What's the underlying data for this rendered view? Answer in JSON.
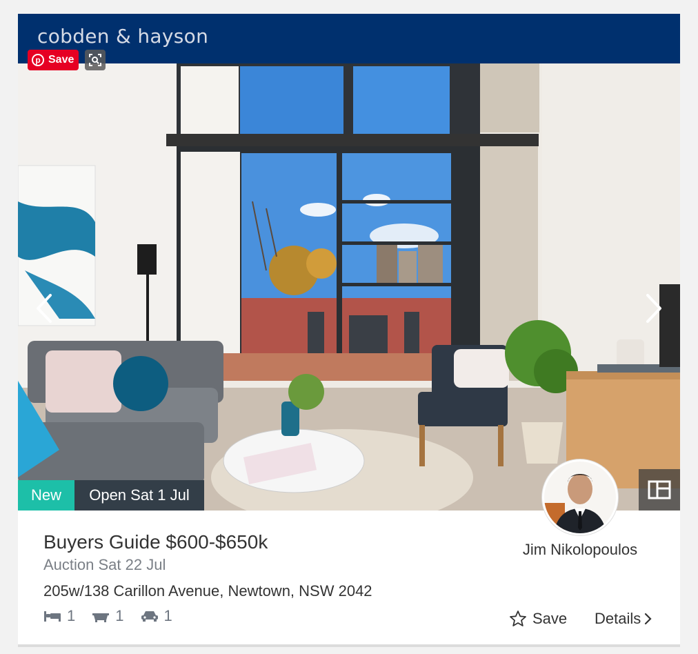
{
  "brand": {
    "logo_text": "cobden & hayson",
    "color": "#00306e"
  },
  "pinterest": {
    "save_label": "Save",
    "color": "#e60023"
  },
  "icons": {
    "prev": "chevron-left-icon",
    "next": "chevron-right-icon",
    "floorplan": "floorplan-icon",
    "lens": "visual-search-icon",
    "bed": "bed-icon",
    "bath": "bath-icon",
    "car": "car-icon",
    "star": "star-outline-icon"
  },
  "badges": {
    "new_label": "New",
    "new_color": "#1dbfa8",
    "open_label": "Open Sat 1 Jul",
    "open_color": "#333e48"
  },
  "listing": {
    "price": "Buyers Guide $600-$650k",
    "auction": "Auction Sat 22 Jul",
    "address": "205w/138 Carillon Avenue, Newtown, NSW 2042",
    "beds": "1",
    "baths": "1",
    "cars": "1"
  },
  "agent": {
    "name": "Jim Nikolopoulos"
  },
  "actions": {
    "save_label": "Save",
    "details_label": "Details"
  }
}
